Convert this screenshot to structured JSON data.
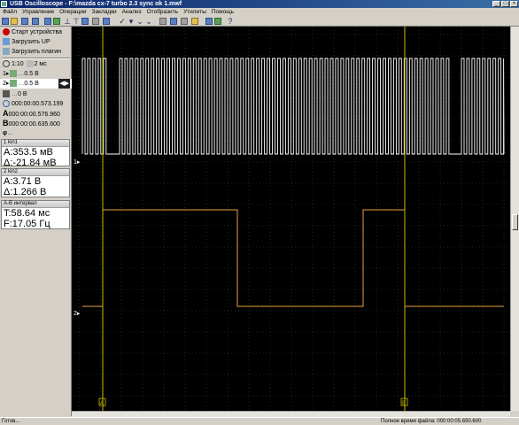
{
  "window": {
    "title": "USB Oscilloscope - F:\\mazda cx-7 turbo 2.3 sync ok 1.mwf"
  },
  "menu": [
    "Файл",
    "Управление",
    "Операции",
    "Закладки",
    "Анализ",
    "Отобразить",
    "Утилиты",
    "Помощь"
  ],
  "sidebar": {
    "start_device": "Старт устройства",
    "load_up": "Загрузить UP",
    "load_plugin": "Загрузить плагин",
    "timebase_ratio": "1:10",
    "timebase": "2 мс",
    "ch1_scale": "0.5 В",
    "ch2_scale": "0.5 В",
    "trigger_level": "0 В",
    "cursor_time": "000:00:00.573.199",
    "cursor_a_label": "A",
    "cursor_a_time": "000:00:00.576.960",
    "cursor_b_label": "B",
    "cursor_b_time": "000:00:00.635.600",
    "phi_label": "φ"
  },
  "readouts": [
    {
      "header": "1 kin1",
      "line1": "A:353.5 мВ",
      "line2": "Δ:-21.84 мВ"
    },
    {
      "header": "2 kin2",
      "line1": "A:3.71 В",
      "line2": "Δ:1.266 В"
    },
    {
      "header": "A-B интервал",
      "line1": "T:58.64 мс",
      "line2": "F:17.05 Гц"
    }
  ],
  "scope": {
    "ch1_marker": "1▸",
    "ch2_marker": "2▸",
    "marker_a": "A",
    "marker_b": "B",
    "ch1_color": "#ffffff",
    "ch2_color": "#e8a040",
    "cursor_color": "#c8c000",
    "grid_color": "#2c4a2c"
  },
  "status": {
    "left": "Готов...",
    "file_time": "Полное время файла: 000:00:05.650.600"
  }
}
